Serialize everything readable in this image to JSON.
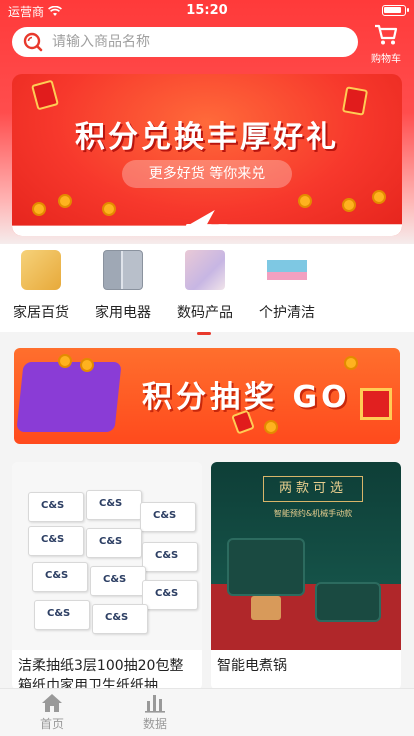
{
  "status_bar": {
    "carrier": "运营商",
    "time": "15:20"
  },
  "search": {
    "placeholder": "请输入商品名称"
  },
  "cart": {
    "label": "购物车"
  },
  "banner": {
    "title": "积分兑换丰厚好礼",
    "subtitle": "更多好货  等你来兑",
    "page_count": 3,
    "active_page": 0
  },
  "categories": [
    {
      "label": "家居百货",
      "icon": "tissue-box-icon"
    },
    {
      "label": "家用电器",
      "icon": "refrigerator-icon"
    },
    {
      "label": "数码产品",
      "icon": "digital-product-icon"
    },
    {
      "label": "个护清洁",
      "icon": "personal-care-icon"
    }
  ],
  "active_category": 2,
  "lottery": {
    "label": "积分抽奖 GO"
  },
  "products": [
    {
      "name": "洁柔抽纸3层100抽20包整箱纸巾家用卫生纸纸抽",
      "brand": "C&S"
    },
    {
      "name": "智能电煮锅",
      "tag": "两款可选",
      "tag_sub": "智能预约&机械手动款"
    }
  ],
  "tabbar": [
    {
      "label": "首页",
      "icon": "home-icon"
    },
    {
      "label": "数据",
      "icon": "bar-chart-icon"
    }
  ],
  "colors": {
    "brand_red": "#ff3a3a",
    "accent_orange": "#ff6f2d"
  }
}
